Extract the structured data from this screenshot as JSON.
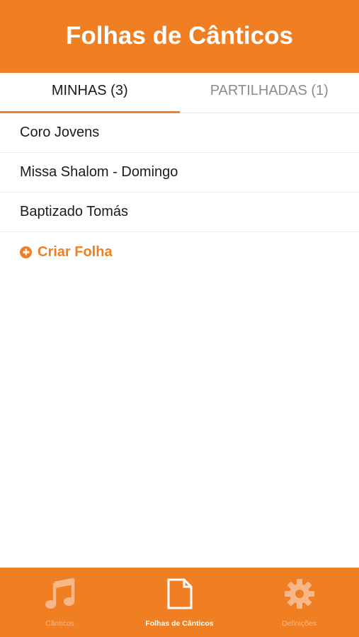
{
  "header": {
    "title": "Folhas de Cânticos"
  },
  "tabs": [
    {
      "label": "MINHAS (3)",
      "active": true
    },
    {
      "label": "PARTILHADAS (1)",
      "active": false
    }
  ],
  "sheets": [
    {
      "name": "Coro Jovens"
    },
    {
      "name": "Missa Shalom - Domingo"
    },
    {
      "name": "Baptizado Tomás"
    }
  ],
  "create": {
    "label": "Criar Folha",
    "icon": "plus-circle-icon"
  },
  "bottom_nav": [
    {
      "label": "Cânticos",
      "icon": "music-note-icon",
      "active": false
    },
    {
      "label": "Folhas de Cânticos",
      "icon": "document-icon",
      "active": true
    },
    {
      "label": "Definições",
      "icon": "gear-icon",
      "active": false
    }
  ],
  "colors": {
    "accent": "#F07F23",
    "inactive_icon": "#F7B789",
    "text": "#1a1a1a"
  }
}
